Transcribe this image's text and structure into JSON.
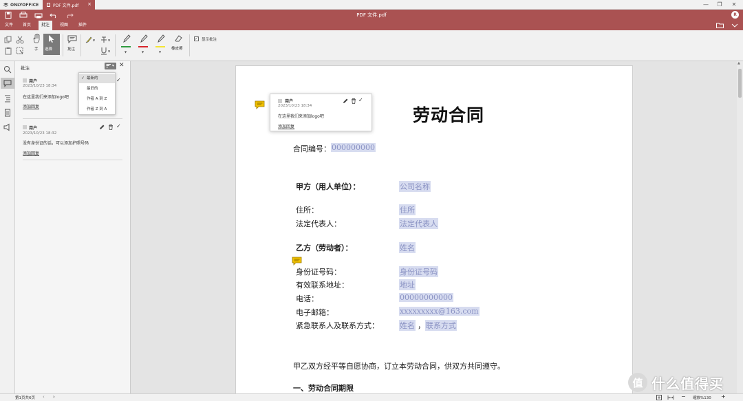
{
  "tabs": {
    "app": "ONLYOFFICE",
    "document": "PDF 文件.pdf",
    "close": "×"
  },
  "window": {
    "minimize": "—",
    "restore": "❐",
    "close": "✕",
    "user_initial": "R"
  },
  "header": {
    "title": "PDF 文件.pdf"
  },
  "menu": [
    "文件",
    "首页",
    "批注",
    "视图",
    "插件"
  ],
  "menu_active": "批注",
  "toolbar": {
    "hand_label": "手",
    "select_label": "选择",
    "comment_label": "批注",
    "eraser_label": "橡皮擦",
    "show_comments_label": "显示批注",
    "show_comments_checked": true,
    "highlight_colors": [
      "#2e9b3e",
      "#d7262b",
      "#f4e533"
    ],
    "text_color": "#e8d400"
  },
  "panel": {
    "title": "批注",
    "comments": [
      {
        "user": "用户",
        "date": "2023/10/23 18:34",
        "text": "在这里我们来添加logo吧",
        "reply": "添加回复"
      },
      {
        "user": "用户",
        "date": "2023/10/23 18:32",
        "text": "没有身份证的话，可以添加护照号码",
        "reply": "添加回复"
      }
    ]
  },
  "sort_menu": {
    "items": [
      "最新的",
      "最旧的",
      "作者 A 到 Z",
      "作者 Z 到 A"
    ],
    "selected_index": 0
  },
  "popup": {
    "user": "用户",
    "date": "2023/10/23 18:34",
    "text": "在这里我们来添加logo吧",
    "reply": "添加回复"
  },
  "document": {
    "title": "劳动合同",
    "contract_no_label": "合同编号：",
    "contract_no": "000000000",
    "party_a_label": "甲方（用人单位）：",
    "party_a": "公司名称",
    "address_label": "住所：",
    "address": "住所",
    "legal_rep_label": "法定代表人：",
    "legal_rep": "法定代表人",
    "party_b_label": "乙方（劳动者）：",
    "party_b": "姓名",
    "id_label": "身份证号码：",
    "id": "身份证号码",
    "contact_addr_label": "有效联系地址：",
    "contact_addr": "地址",
    "phone_label": "电话：",
    "phone": "00000000000",
    "email_label": "电子邮箱：",
    "email": "xxxxxxxxx@163.com",
    "emergency_label": "紧急联系人及联系方式：",
    "emergency_name": "姓名",
    "emergency_sep": "，",
    "emergency_contact": "联系方式",
    "agreement": "甲乙双方经平等自愿协商，订立本劳动合同，供双方共同遵守。",
    "section1": "一、劳动合同期限"
  },
  "status": {
    "page": "第1页共6页",
    "zoom": "缩放%130",
    "zoom_in": "+",
    "zoom_out": "−"
  },
  "watermark": {
    "badge": "值",
    "text": "什么值得买"
  }
}
